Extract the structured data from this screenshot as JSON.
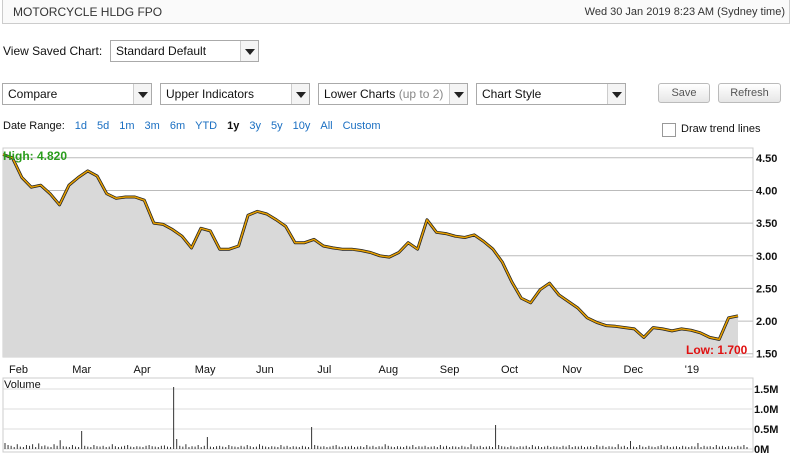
{
  "header": {
    "title": "MOTORCYCLE HLDG FPO",
    "datetime": "Wed 30 Jan 2019 8:23 AM (Sydney time)"
  },
  "saved_chart": {
    "label": "View Saved Chart:",
    "value": "Standard Default"
  },
  "toolbar": {
    "compare": "Compare",
    "upper": "Upper Indicators",
    "lower": "Lower Charts",
    "lower_hint": "(up to 2)",
    "style": "Chart Style",
    "save": "Save",
    "refresh": "Refresh"
  },
  "date_range": {
    "label": "Date Range:",
    "options": [
      "1d",
      "5d",
      "1m",
      "3m",
      "6m",
      "YTD",
      "1y",
      "3y",
      "5y",
      "10y",
      "All",
      "Custom"
    ],
    "selected": "1y"
  },
  "trend_lines": {
    "label": "Draw trend lines",
    "checked": false
  },
  "chart_data": {
    "type": "area",
    "high_label": "High: 4.820",
    "low_label": "Low: 1.700",
    "y_ticks": [
      "4.50",
      "4.00",
      "3.50",
      "3.00",
      "2.50",
      "2.00",
      "1.50"
    ],
    "ylim": [
      1.45,
      4.65
    ],
    "months": [
      "Feb",
      "Mar",
      "Apr",
      "May",
      "Jun",
      "Jul",
      "Aug",
      "Sep",
      "Oct",
      "Nov",
      "Dec",
      "'19"
    ],
    "x": [
      "Feb",
      "",
      "",
      "",
      "",
      "Mar",
      "",
      "",
      "",
      "",
      "Apr",
      "",
      "",
      "",
      "",
      "May",
      "",
      "",
      "",
      "",
      "Jun",
      "",
      "",
      "",
      "",
      "Jul",
      "",
      "",
      "",
      "",
      "Aug",
      "",
      "",
      "",
      "",
      "Sep",
      "",
      "",
      "",
      "",
      "Oct",
      "",
      "",
      "",
      "",
      "Nov",
      "",
      "",
      "",
      "",
      "Dec",
      "",
      "",
      "",
      "",
      "Jan"
    ],
    "price": [
      4.55,
      4.5,
      4.2,
      4.05,
      4.08,
      3.95,
      3.78,
      4.08,
      4.2,
      4.3,
      4.22,
      3.95,
      3.88,
      3.9,
      3.9,
      3.85,
      3.5,
      3.48,
      3.4,
      3.3,
      3.12,
      3.42,
      3.38,
      3.1,
      3.1,
      3.15,
      3.62,
      3.68,
      3.64,
      3.55,
      3.45,
      3.2,
      3.2,
      3.25,
      3.15,
      3.12,
      3.1,
      3.1,
      3.08,
      3.05,
      3.0,
      2.98,
      3.05,
      3.2,
      3.1,
      3.55,
      3.36,
      3.34,
      3.3,
      3.28,
      3.32,
      3.22,
      3.1,
      2.9,
      2.6,
      2.35,
      2.28,
      2.48,
      2.58,
      2.4,
      2.3,
      2.2,
      2.05,
      1.98,
      1.93,
      1.92,
      1.9,
      1.88,
      1.75,
      1.9,
      1.88,
      1.85,
      1.88,
      1.86,
      1.82,
      1.75,
      1.72,
      2.05,
      2.08
    ],
    "volume_title": "Volume",
    "volume_ticks": [
      "1.5M",
      "1.0M",
      "0.5M",
      "0M"
    ],
    "volume_max": 1.6,
    "volume": [
      0.15,
      0.1,
      0.08,
      0.05,
      0.12,
      0.06,
      0.05,
      0.1,
      0.08,
      0.12,
      0.05,
      0.14,
      0.07,
      0.09,
      0.06,
      0.05,
      0.12,
      0.08,
      0.22,
      0.07,
      0.06,
      0.05,
      0.1,
      0.06,
      0.05,
      0.45,
      0.08,
      0.06,
      0.05,
      0.1,
      0.07,
      0.06,
      0.08,
      0.05,
      0.06,
      0.12,
      0.07,
      0.05,
      0.06,
      0.08,
      0.1,
      0.06,
      0.05,
      0.07,
      0.06,
      0.05,
      0.08,
      0.1,
      0.07,
      0.06,
      0.05,
      0.08,
      0.09,
      0.06,
      0.05,
      1.55,
      0.25,
      0.08,
      0.06,
      0.12,
      0.05,
      0.07,
      0.06,
      0.1,
      0.05,
      0.08,
      0.3,
      0.06,
      0.05,
      0.07,
      0.08,
      0.06,
      0.05,
      0.1,
      0.07,
      0.06,
      0.05,
      0.08,
      0.06,
      0.1,
      0.07,
      0.05,
      0.06,
      0.12,
      0.08,
      0.06,
      0.05,
      0.07,
      0.06,
      0.05,
      0.1,
      0.06,
      0.08,
      0.05,
      0.07,
      0.06,
      0.05,
      0.08,
      0.06,
      0.05,
      0.55,
      0.1,
      0.08,
      0.06,
      0.07,
      0.05,
      0.06,
      0.08,
      0.1,
      0.06,
      0.05,
      0.07,
      0.06,
      0.08,
      0.05,
      0.06,
      0.07,
      0.05,
      0.1,
      0.06,
      0.08,
      0.05,
      0.07,
      0.06,
      0.12,
      0.08,
      0.06,
      0.05,
      0.07,
      0.06,
      0.05,
      0.08,
      0.06,
      0.1,
      0.05,
      0.07,
      0.06,
      0.08,
      0.05,
      0.06,
      0.07,
      0.05,
      0.1,
      0.06,
      0.08,
      0.05,
      0.07,
      0.06,
      0.05,
      0.08,
      0.06,
      0.05,
      0.12,
      0.07,
      0.06,
      0.08,
      0.05,
      0.06,
      0.07,
      0.05,
      0.6,
      0.1,
      0.07,
      0.06,
      0.05,
      0.08,
      0.06,
      0.05,
      0.07,
      0.06,
      0.08,
      0.05,
      0.1,
      0.06,
      0.07,
      0.05,
      0.06,
      0.08,
      0.05,
      0.07,
      0.06,
      0.05,
      0.08,
      0.06,
      0.1,
      0.05,
      0.07,
      0.06,
      0.08,
      0.05,
      0.06,
      0.07,
      0.05,
      0.1,
      0.06,
      0.08,
      0.05,
      0.07,
      0.06,
      0.05,
      0.12,
      0.06,
      0.08,
      0.05,
      0.2,
      0.06,
      0.05,
      0.1,
      0.06,
      0.05,
      0.08,
      0.06,
      0.05,
      0.07,
      0.1,
      0.06,
      0.08,
      0.05,
      0.06,
      0.07,
      0.05,
      0.08,
      0.06,
      0.05,
      0.07,
      0.06,
      0.15,
      0.05,
      0.08,
      0.06,
      0.07,
      0.05,
      0.1,
      0.06,
      0.08,
      0.05,
      0.07,
      0.06,
      0.05,
      0.08,
      0.06,
      0.1,
      0.05
    ],
    "colors": {
      "line": "#e8a000",
      "fill": "#d9d9d9",
      "high": "#2a9d1c",
      "low": "#e01010",
      "volume": "#333333"
    }
  }
}
